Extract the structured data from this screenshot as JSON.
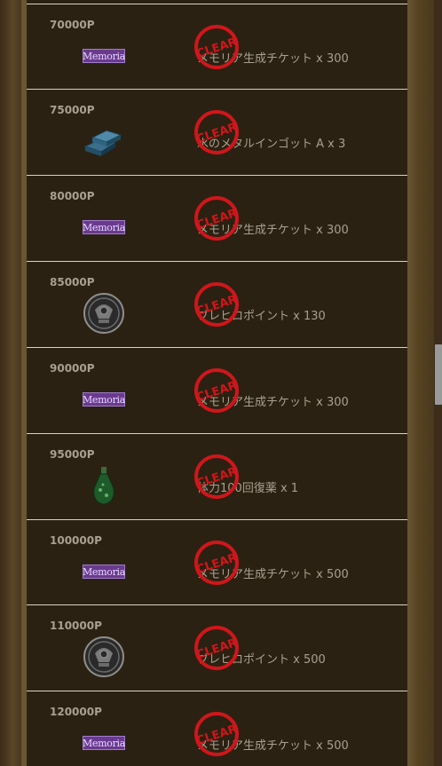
{
  "stamp_text": "CLEAR",
  "icon_colors": {
    "memoria_bg": "#6a3a8f",
    "stamp_red": "#d0161b"
  },
  "rows": [
    {
      "points": "70000P",
      "icon": "memoria-badge",
      "icon_text": "Memoria",
      "reward": "メモリア生成チケット x 300"
    },
    {
      "points": "75000P",
      "icon": "ingot-icon",
      "icon_text": "",
      "reward": "水のメタルインゴット A x 3"
    },
    {
      "points": "80000P",
      "icon": "memoria-badge",
      "icon_text": "Memoria",
      "reward": "メモリア生成チケット x 300"
    },
    {
      "points": "85000P",
      "icon": "coin-icon",
      "icon_text": "",
      "reward": "ブレヒロポイント x 130"
    },
    {
      "points": "90000P",
      "icon": "memoria-badge",
      "icon_text": "Memoria",
      "reward": "メモリア生成チケット x 300"
    },
    {
      "points": "95000P",
      "icon": "potion-icon",
      "icon_text": "",
      "reward": "体力100回復薬 x 1"
    },
    {
      "points": "100000P",
      "icon": "memoria-badge",
      "icon_text": "Memoria",
      "reward": "メモリア生成チケット x 500"
    },
    {
      "points": "110000P",
      "icon": "coin-icon",
      "icon_text": "",
      "reward": "ブレヒロポイント x 500"
    },
    {
      "points": "120000P",
      "icon": "memoria-badge",
      "icon_text": "Memoria",
      "reward": "メモリア生成チケット x 500"
    }
  ]
}
